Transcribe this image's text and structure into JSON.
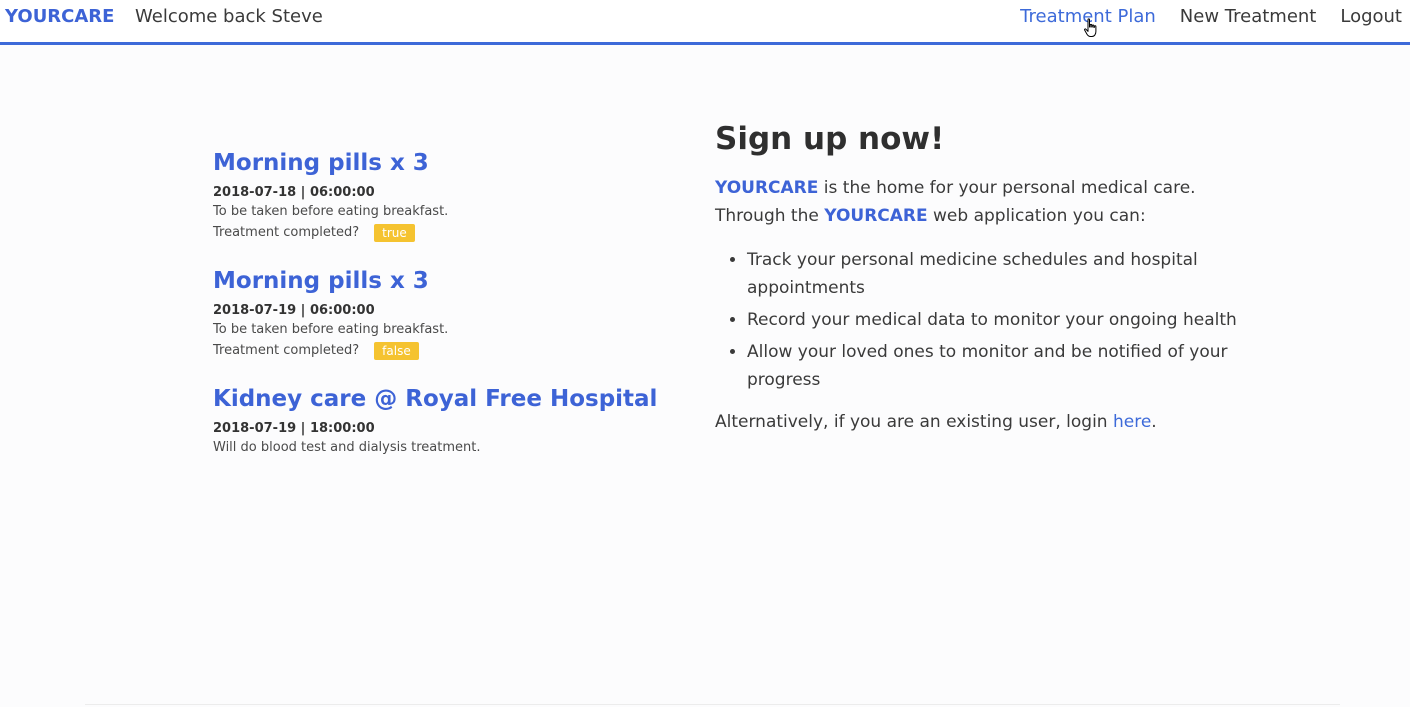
{
  "navbar": {
    "brand": "YOURCARE",
    "welcome": "Welcome back Steve",
    "links": [
      {
        "label": "Treatment Plan",
        "active": true
      },
      {
        "label": "New Treatment",
        "active": false
      },
      {
        "label": "Logout",
        "active": false
      }
    ]
  },
  "treatments": [
    {
      "title": "Morning pills x 3",
      "datetime": "2018-07-18 | 06:00:00",
      "description": "To be taken before eating breakfast.",
      "status_label": "Treatment completed?",
      "status_value": "true"
    },
    {
      "title": "Morning pills x 3",
      "datetime": "2018-07-19 | 06:00:00",
      "description": "To be taken before eating breakfast.",
      "status_label": "Treatment completed?",
      "status_value": "false"
    },
    {
      "title": "Kidney care @ Royal Free Hospital",
      "datetime": "2018-07-19 | 18:00:00",
      "description": "Will do blood test and dialysis treatment."
    }
  ],
  "signup": {
    "title": "Sign up now!",
    "brand": "YOURCARE",
    "intro_1": " is the home for your personal medical care.",
    "intro_2_prefix": "Through the ",
    "intro_2_suffix": " web application you can:",
    "features": [
      "Track your personal medicine schedules and hospital appointments",
      "Record your medical data to monitor your ongoing health",
      "Allow your loved ones to monitor and be notified of your progress"
    ],
    "alt_prefix": "Alternatively, if you are an existing user, login ",
    "alt_link": "here",
    "alt_suffix": "."
  },
  "colors": {
    "accent": "#3d63d6",
    "badge": "#f5c330",
    "text": "#3a3a3a"
  }
}
